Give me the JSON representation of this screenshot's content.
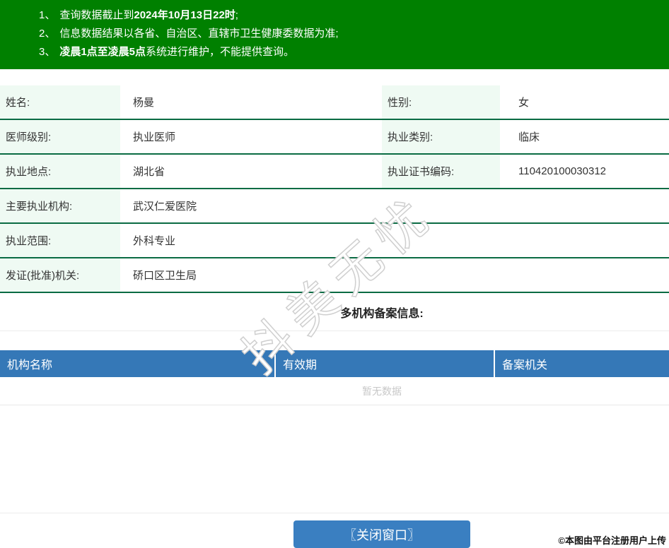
{
  "colors": {
    "banner_green": "#008000",
    "row_separator_green": "#0a6b43",
    "label_cell_mint": "#effaf3",
    "table_header_blue": "#3578b7",
    "button_blue": "#3a7fc1",
    "empty_text_gray": "#c8c8c8"
  },
  "notice": {
    "items": [
      {
        "num": "1、",
        "pre": "查询数据截止到",
        "bold": "2024年10月13日22时",
        "post": ";"
      },
      {
        "num": "2、",
        "pre": "信息数据结果以各省、自治区、直辖市卫生健康委数据为准;",
        "bold": "",
        "post": ""
      },
      {
        "num": "3、",
        "pre": "",
        "bold": "凌晨1点至凌晨5点",
        "post": "系统进行维护，不能提供查询。"
      }
    ]
  },
  "info": {
    "rows": [
      {
        "cells": [
          {
            "label": "姓名:",
            "value": "杨曼"
          },
          {
            "label": "性别:",
            "value": "女"
          }
        ]
      },
      {
        "cells": [
          {
            "label": "医师级别:",
            "value": "执业医师"
          },
          {
            "label": "执业类别:",
            "value": "临床"
          }
        ]
      },
      {
        "cells": [
          {
            "label": "执业地点:",
            "value": "湖北省"
          },
          {
            "label": "执业证书编码:",
            "value": "110420100030312"
          }
        ]
      },
      {
        "cells": [
          {
            "label": "主要执业机构:",
            "value": "武汉仁爱医院"
          }
        ]
      },
      {
        "cells": [
          {
            "label": "执业范围:",
            "value": "外科专业"
          }
        ]
      },
      {
        "cells": [
          {
            "label": "发证(批准)机关:",
            "value": "硚口区卫生局"
          }
        ]
      }
    ]
  },
  "section": {
    "title": "多机构备案信息:"
  },
  "records": {
    "headers": [
      "机构名称",
      "有效期",
      "备案机关"
    ],
    "empty_text": "暂无数据",
    "rows": []
  },
  "watermark": {
    "text": "抖美无忧"
  },
  "footer": {
    "close_button": "〖关闭窗口〗",
    "copyright": "©本图由平台注册用户上传"
  }
}
